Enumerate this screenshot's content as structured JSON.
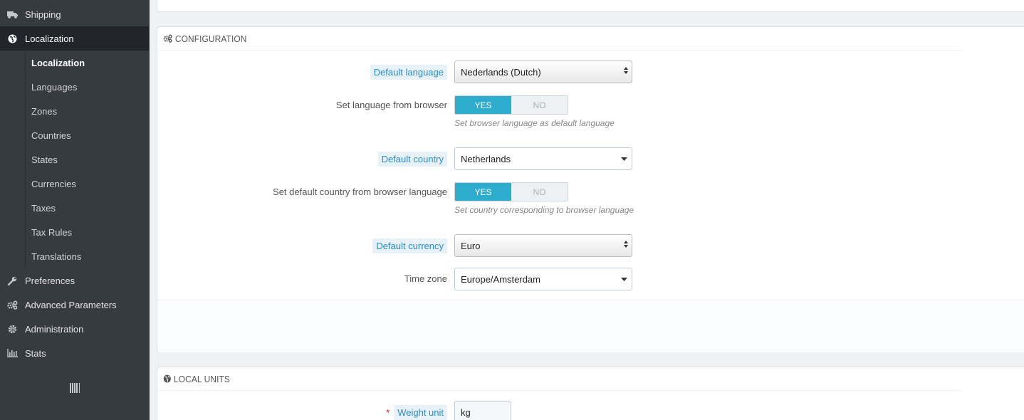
{
  "sidebar": {
    "items": [
      {
        "label": "Shipping",
        "icon": "truck-icon"
      },
      {
        "label": "Localization",
        "icon": "globe-icon"
      },
      {
        "label": "Preferences",
        "icon": "wrench-icon"
      },
      {
        "label": "Advanced Parameters",
        "icon": "cogs-icon"
      },
      {
        "label": "Administration",
        "icon": "gear-icon"
      },
      {
        "label": "Stats",
        "icon": "bar-chart-icon"
      }
    ],
    "submenu": [
      "Localization",
      "Languages",
      "Zones",
      "Countries",
      "States",
      "Currencies",
      "Taxes",
      "Tax Rules",
      "Translations"
    ]
  },
  "config": {
    "title": "CONFIGURATION",
    "default_language": {
      "label": "Default language",
      "value": "Nederlands (Dutch)"
    },
    "lang_from_browser": {
      "label": "Set language from browser",
      "yes": "YES",
      "no": "NO",
      "help": "Set browser language as default language"
    },
    "default_country": {
      "label": "Default country",
      "value": "Netherlands"
    },
    "country_from_browser": {
      "label": "Set default country from browser language",
      "yes": "YES",
      "no": "NO",
      "help": "Set country corresponding to browser language"
    },
    "default_currency": {
      "label": "Default currency",
      "value": "Euro"
    },
    "time_zone": {
      "label": "Time zone",
      "value": "Europe/Amsterdam"
    }
  },
  "local_units": {
    "title": "LOCAL UNITS",
    "required_mark": "*",
    "weight_unit": {
      "label": "Weight unit",
      "value": "kg"
    }
  },
  "colors": {
    "sidebar": "#363a41",
    "active": "#222529",
    "accent": "#2eacce",
    "highlight_text": "#2b8cc4"
  }
}
